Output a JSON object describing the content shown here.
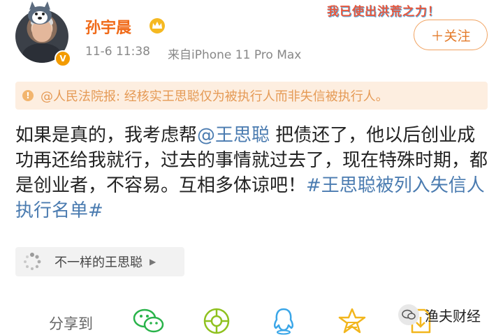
{
  "header": {
    "slogan": "我已使出洪荒之力！",
    "username": "孙宇晨",
    "time": "11-6 11:38",
    "source": "来自iPhone 11 Pro Max",
    "follow_label": "＋关注"
  },
  "notice": {
    "text": "@人民法院报: 经核实王思聪仅为被执行人而非失信被执行人。"
  },
  "post": {
    "part1": "如果是真的，我考虑帮",
    "mention": "@王思聪",
    "part2": " 把债还了，他以后创业成功再还给我就行，过去的事情就过去了，现在特殊时期，都是创业者，不容易。互相多体谅吧！",
    "hashtag": "#王思聪被列入失信人执行名单#"
  },
  "link_card": {
    "label": "不一样的王思聪",
    "icon": "loading-icon"
  },
  "share": {
    "label": "分享到",
    "icons": [
      "wechat-icon",
      "moments-icon",
      "qq-icon",
      "qzone-icon",
      "save-icon"
    ]
  },
  "watermark": {
    "text": "渔夫财经"
  },
  "colors": {
    "username": "#f06a18",
    "link": "#4a7bb0",
    "notice_bg": "#fdeee0",
    "notice_text": "#e59a55",
    "wechat": "#29b34a",
    "moments": "#8fc11f",
    "qq": "#3aa6e8",
    "qzone": "#f2b61d"
  }
}
